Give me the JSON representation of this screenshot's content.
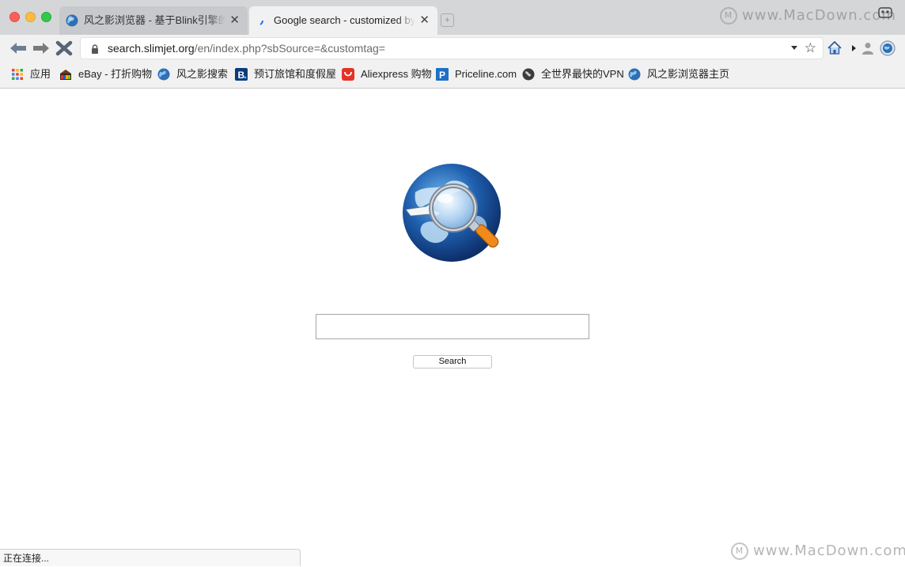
{
  "window": {
    "tabs": [
      {
        "title": "风之影浏览器 - 基于Blink引擎的高",
        "close": "✕",
        "favicon": "globe-icon",
        "active": false
      },
      {
        "title": "Google search - customized by Fla",
        "close": "✕",
        "favicon": "loading-spinner-icon",
        "active": true
      }
    ],
    "new_tab_glyph": "+",
    "watermark": "www.MacDown.com"
  },
  "toolbar": {
    "url_host": "search.slimjet.org",
    "url_path": "/en/index.php?sbSource=&customtag=",
    "star_glyph": "☆"
  },
  "bookmarks": [
    {
      "label": "应用",
      "icon": "apps-grid-icon"
    },
    {
      "label": "eBay - 打折购物",
      "icon": "ebay-icon"
    },
    {
      "label": "风之影搜索",
      "icon": "globe-icon"
    },
    {
      "label": "预订旅馆和度假屋",
      "icon": "booking-icon"
    },
    {
      "label": "Aliexpress 购物",
      "icon": "aliexpress-icon"
    },
    {
      "label": "Priceline.com",
      "icon": "priceline-icon"
    },
    {
      "label": "全世界最快的VPN",
      "icon": "vpn-globe-icon"
    },
    {
      "label": "风之影浏览器主页",
      "icon": "globe-icon"
    }
  ],
  "content": {
    "search_placeholder": "",
    "search_button": "Search"
  },
  "status_text": "正在连接...",
  "colors": {
    "tab_strip": "#d5d6d8",
    "toolbar": "#f1f1f2",
    "close_red": "#fc605b",
    "minimize_yellow": "#fdbc40",
    "zoom_green": "#34c84a"
  }
}
